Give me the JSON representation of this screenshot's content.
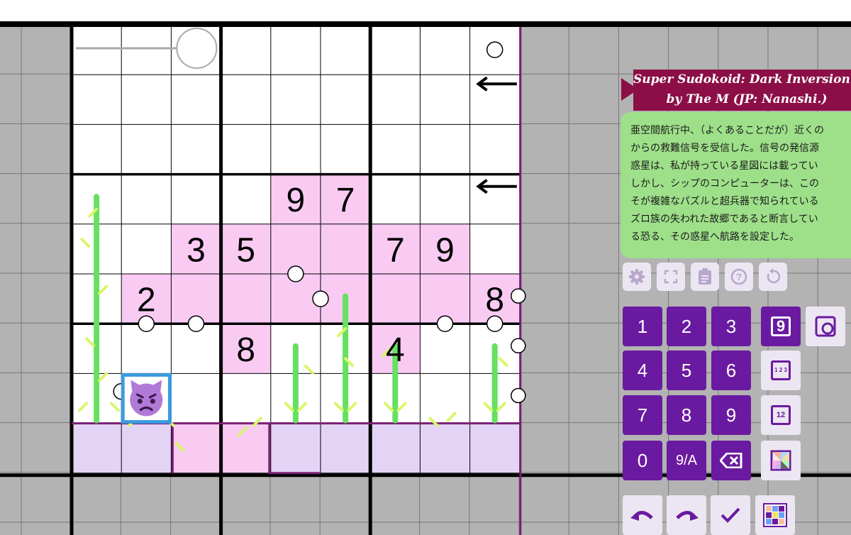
{
  "puzzle": {
    "title_line1": "Super Sudokoid: Dark Inversion (J",
    "title_line2": "by The M (JP: Nanashi.)",
    "rules_text": "亜空間航行中、（よくあることだが）近くの\nからの救難信号を受信した。信号の発信源\n惑星は、私が持っている星図には載ってい\nしかし、シップのコンピューターは、この\nそが複雑なパズルと超兵器で知られている\nズロ族の失われた故郷であると断言してい\nる恐る、その惑星へ航路を設定した。",
    "givens": [
      {
        "row": 3,
        "col": 4,
        "value": "9"
      },
      {
        "row": 3,
        "col": 5,
        "value": "7"
      },
      {
        "row": 4,
        "col": 2,
        "value": "3"
      },
      {
        "row": 4,
        "col": 3,
        "value": "5"
      },
      {
        "row": 4,
        "col": 6,
        "value": "7"
      },
      {
        "row": 4,
        "col": 7,
        "value": "9"
      },
      {
        "row": 5,
        "col": 1,
        "value": "2"
      },
      {
        "row": 5,
        "col": 8,
        "value": "8"
      },
      {
        "row": 6,
        "col": 3,
        "value": "8"
      },
      {
        "row": 6,
        "col": 6,
        "value": "4"
      }
    ],
    "pink_cells": [
      [
        3,
        4
      ],
      [
        3,
        5
      ],
      [
        4,
        2
      ],
      [
        4,
        3
      ],
      [
        4,
        4
      ],
      [
        4,
        5
      ],
      [
        4,
        6
      ],
      [
        4,
        7
      ],
      [
        5,
        1
      ],
      [
        5,
        2
      ],
      [
        5,
        3
      ],
      [
        5,
        4
      ],
      [
        5,
        5
      ],
      [
        5,
        6
      ],
      [
        5,
        7
      ],
      [
        5,
        8
      ],
      [
        6,
        3
      ],
      [
        6,
        6
      ],
      [
        8,
        2
      ],
      [
        8,
        3
      ]
    ],
    "lavender_cells": [
      [
        8,
        0
      ],
      [
        8,
        1
      ],
      [
        8,
        4
      ],
      [
        8,
        5
      ],
      [
        8,
        6
      ],
      [
        8,
        7
      ],
      [
        8,
        8
      ]
    ],
    "player_cell": {
      "row": 7,
      "col": 1
    },
    "arrows_rows": [
      1,
      3
    ],
    "colors": {
      "pink": "#f9cbf3",
      "lavender": "#e3d4f5",
      "purple_line": "#7a1f74",
      "vine": "#66e060",
      "vine_tip": "#d8f76a",
      "player_border": "#3a9be0",
      "player_face": "#b07ad8",
      "keypad": "#6a1aa0",
      "banner": "#8b0f46",
      "rules_bg": "#9ee08a"
    }
  },
  "toolbar": {
    "settings_icon": "gear-icon",
    "fullscreen_icon": "fullscreen-icon",
    "rules_icon": "clipboard-icon",
    "help_icon": "question-icon",
    "restart_icon": "restart-icon"
  },
  "keypad": {
    "keys": [
      "1",
      "2",
      "3",
      "4",
      "5",
      "6",
      "7",
      "8",
      "9",
      "0",
      "9/A"
    ],
    "modes": {
      "normal": "9",
      "corner": "1 2 3",
      "center": "12"
    }
  }
}
